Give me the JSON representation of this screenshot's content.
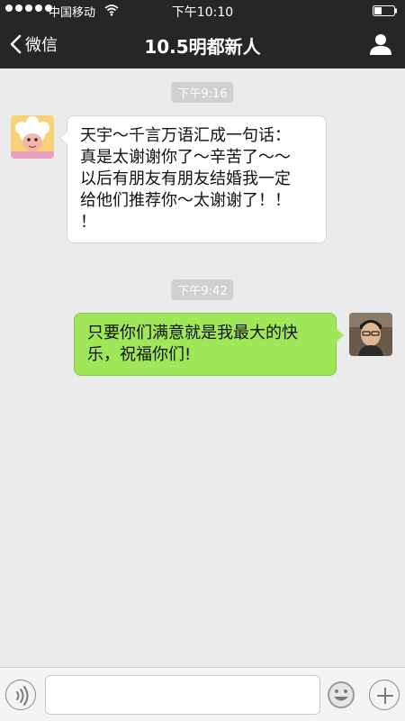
{
  "status_bar": {
    "carrier": "中国移动",
    "time": "下午10:10"
  },
  "nav": {
    "back_label": "微信",
    "title": "10.5明都新人"
  },
  "messages": [
    {
      "timestamp": "下午9:16",
      "side": "left",
      "lines": [
        "天宇～千言万语汇成一句话：",
        "真是太谢谢你了～辛苦了～～",
        "以后有朋友有朋友结婚我一定",
        "给他们推荐你～太谢谢了！！",
        "！"
      ]
    },
    {
      "timestamp": "下午9:42",
      "side": "right",
      "lines": [
        "只要你们满意就是我最大的快",
        "乐，祝福你们!"
      ]
    }
  ],
  "input": {
    "value": "",
    "placeholder": ""
  },
  "icons": {
    "back": "chevron-left-icon",
    "profile": "person-icon",
    "voice": "voice-icon",
    "emoji": "emoji-icon",
    "plus": "plus-icon"
  },
  "colors": {
    "header_bg": "#262626",
    "chat_bg": "#ebebeb",
    "sent_bubble": "#9fe659",
    "received_bubble": "#ffffff"
  }
}
